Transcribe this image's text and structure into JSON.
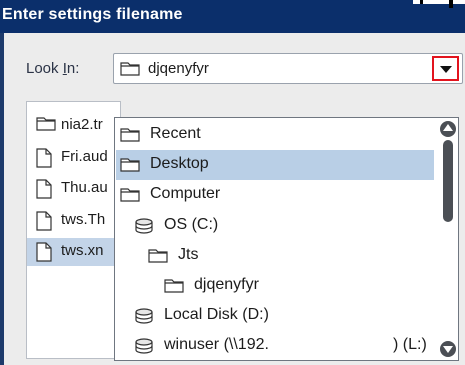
{
  "window": {
    "title": "Enter settings filename"
  },
  "look_in": {
    "label_prefix": "Look ",
    "label_mnemonic": "I",
    "label_suffix": "n:",
    "value": "djqenyfyr"
  },
  "files": [
    {
      "name": "nia2.tr",
      "icon": "folder-icon",
      "selected": false
    },
    {
      "name": "Fri.aud",
      "icon": "file-icon",
      "selected": false
    },
    {
      "name": "Thu.au",
      "icon": "file-icon",
      "selected": false
    },
    {
      "name": "tws.Th",
      "icon": "file-icon",
      "selected": false
    },
    {
      "name": "tws.xn",
      "icon": "file-icon",
      "selected": true
    }
  ],
  "dropdown": {
    "items": [
      {
        "label": "Recent",
        "icon": "folder-icon",
        "level": 0,
        "selected": false
      },
      {
        "label": "Desktop",
        "icon": "folder-icon",
        "level": 0,
        "selected": true
      },
      {
        "label": "Computer",
        "icon": "folder-icon",
        "level": 1,
        "selected": false
      },
      {
        "label": "OS (C:)",
        "icon": "drive-icon",
        "level": 2,
        "selected": false
      },
      {
        "label": "Jts",
        "icon": "folder-icon",
        "level": 3,
        "selected": false
      },
      {
        "label": "djqenyfyr",
        "icon": "folder-icon",
        "level": 4,
        "selected": false
      },
      {
        "label": "Local Disk (D:)",
        "icon": "drive-icon",
        "level": 2,
        "selected": false
      },
      {
        "label": "winuser (\\\\192.",
        "label_suffix": ") (L:)",
        "icon": "drive-icon",
        "level": 2,
        "selected": false
      }
    ]
  },
  "colors": {
    "titlebar": "#0b2f6b",
    "selection": "#b9cfe6",
    "arrow_highlight": "#e2141e"
  }
}
